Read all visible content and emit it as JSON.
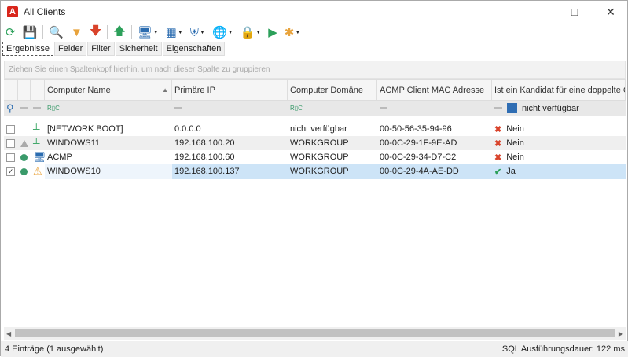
{
  "window": {
    "title": "All Clients",
    "logo": "A"
  },
  "toolbar": {
    "icons": [
      "refresh-icon",
      "save-icon",
      "computer-search-icon",
      "filter-icon",
      "arrow-down-icon",
      "arrow-up-icon",
      "computer-settings-icon",
      "layout-grid-icon",
      "shield-settings-icon",
      "network-lock-icon",
      "lock-icon",
      "play-icon",
      "puzzle-icon"
    ]
  },
  "tabs": [
    "Ergebnisse",
    "Felder",
    "Filter",
    "Sicherheit",
    "Eigenschaften"
  ],
  "group_panel": "Ziehen Sie einen Spaltenkopf hierhin, um nach dieser Spalte zu gruppieren",
  "columns": [
    "Computer Name",
    "Primäre IP",
    "Computer Domäne",
    "ACMP Client MAC Adresse",
    "Ist ein Kandidat für eine doppelte Cli"
  ],
  "filter": {
    "candidate": "nicht verfügbar",
    "rbc": "R▯C"
  },
  "rows": [
    {
      "checked": false,
      "status": "none",
      "icon": "network-boot-icon",
      "name": "[NETWORK BOOT]",
      "ip": "0.0.0.0",
      "domain": "nicht verfügbar",
      "mac": "00-50-56-35-94-96",
      "candidate": "Nein"
    },
    {
      "checked": false,
      "status": "triangle",
      "icon": "network-boot-icon",
      "name": "WINDOWS11",
      "ip": "192.168.100.20",
      "domain": "WORKGROUP",
      "mac": "00-0C-29-1F-9E-AD",
      "candidate": "Nein"
    },
    {
      "checked": false,
      "status": "online",
      "icon": "computer-icon",
      "name": "ACMP",
      "ip": "192.168.100.60",
      "domain": "WORKGROUP",
      "mac": "00-0C-29-34-D7-C2",
      "candidate": "Nein"
    },
    {
      "checked": true,
      "status": "online",
      "icon": "warning-icon",
      "name": "WINDOWS10",
      "ip": "192.168.100.137",
      "domain": "WORKGROUP",
      "mac": "00-0C-29-4A-AE-DD",
      "candidate": "Ja"
    }
  ],
  "status": {
    "left": "4 Einträge (1 ausgewählt)",
    "right": "SQL Ausführungsdauer: 122 ms"
  }
}
